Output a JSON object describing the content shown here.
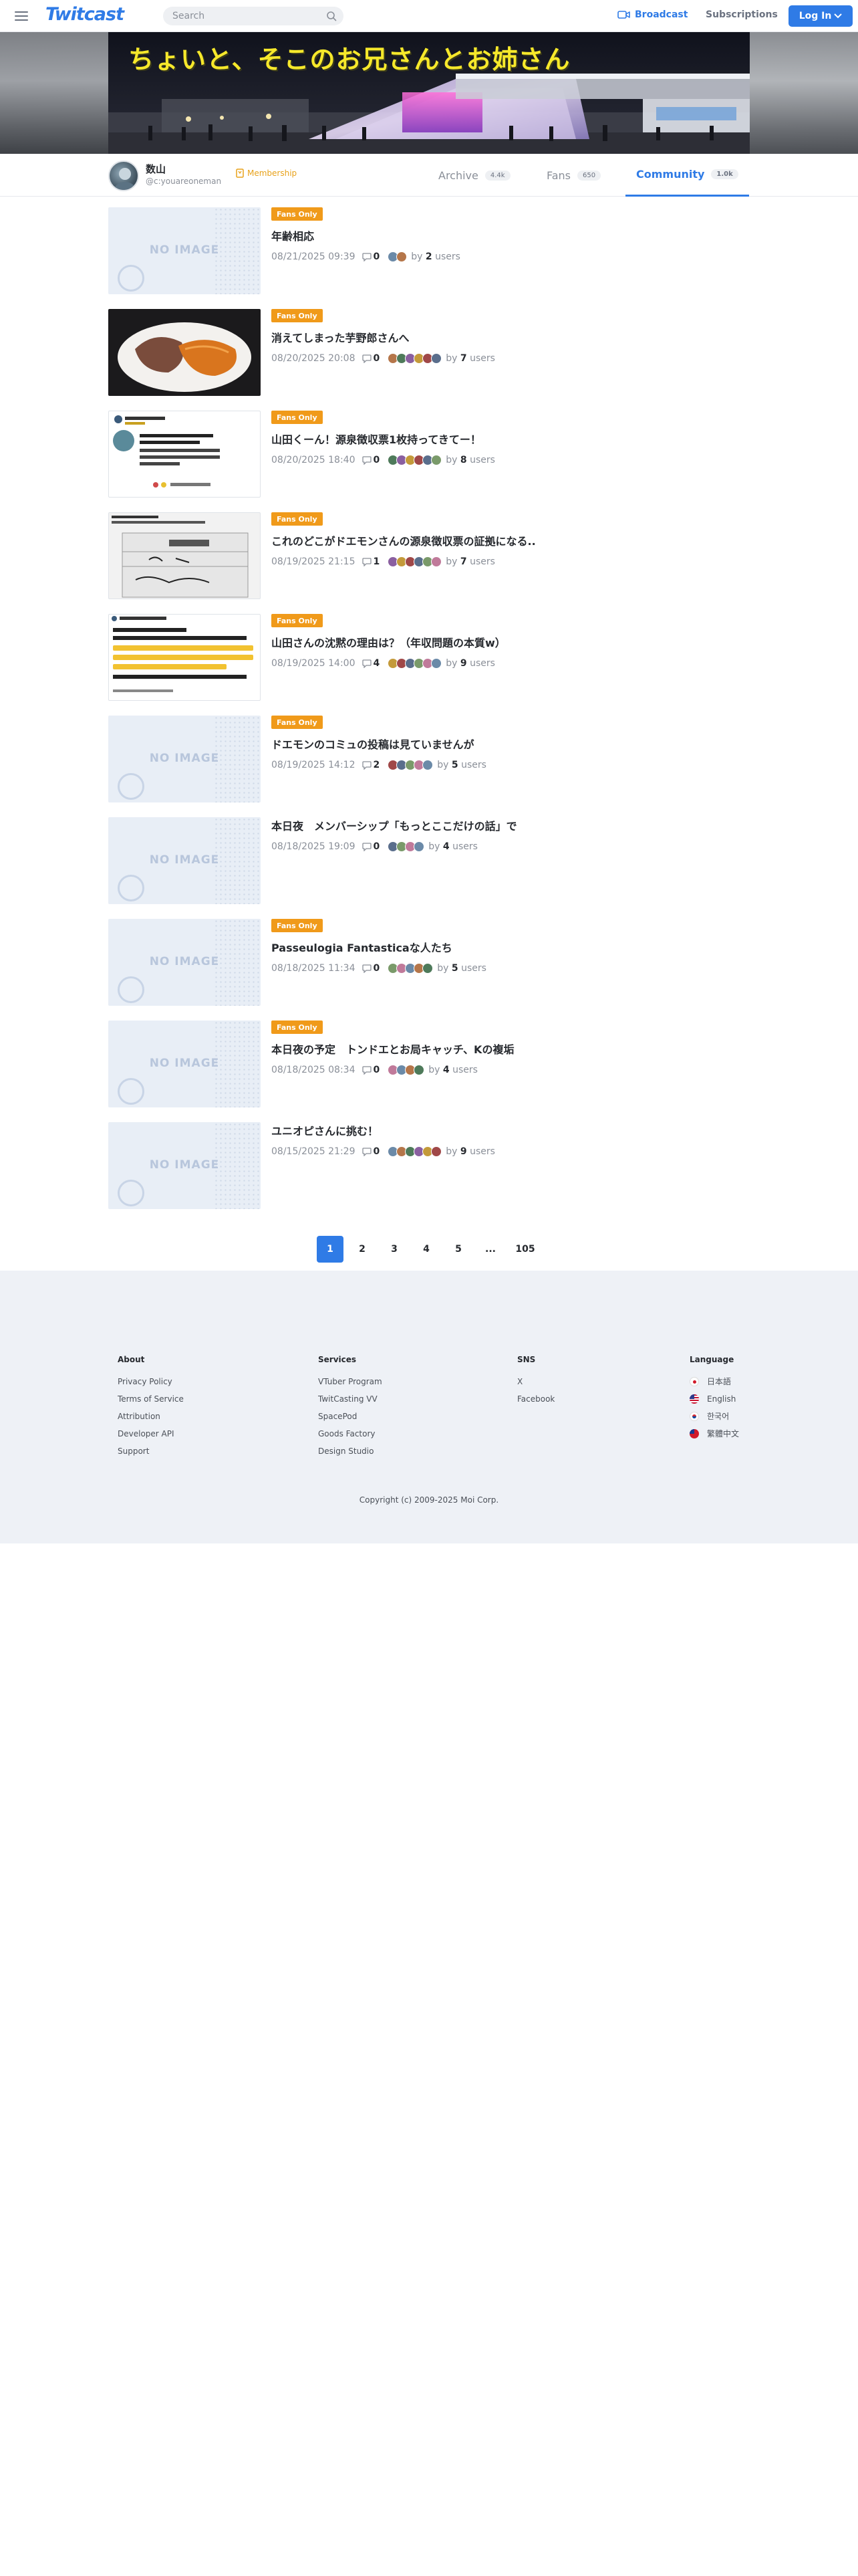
{
  "header": {
    "logo": "Twitcast",
    "search_placeholder": "Search",
    "broadcast_label": "Broadcast",
    "subscriptions_label": "Subscriptions",
    "login_label": "Log In"
  },
  "banner": {
    "title": "ちょいと、そこのお兄さんとお姉さん"
  },
  "profile": {
    "name": "数山",
    "handle": "@c:youareoneman",
    "membership_label": "Membership"
  },
  "tabs": [
    {
      "label": "Archive",
      "count": "4.4k"
    },
    {
      "label": "Fans",
      "count": "650"
    },
    {
      "label": "Community",
      "count": "1.0k"
    }
  ],
  "posts": [
    {
      "badge": "Fans Only",
      "title": "年齢相応",
      "date": "08/21/2025 09:39",
      "comments": "0",
      "users": "2",
      "thumb": "noimage"
    },
    {
      "badge": "Fans Only",
      "title": "消えてしまった芋野郎さんへ",
      "date": "08/20/2025 20:08",
      "comments": "0",
      "users": "7",
      "thumb": "food"
    },
    {
      "badge": "Fans Only",
      "title": "山田くーん！源泉徴収票1枚持ってきてー！",
      "date": "08/20/2025 18:40",
      "comments": "0",
      "users": "8",
      "thumb": "tweet"
    },
    {
      "badge": "Fans Only",
      "title": "これのどこがドエモンさんの源泉徴収票の証拠になる..",
      "date": "08/19/2025 21:15",
      "comments": "1",
      "users": "7",
      "thumb": "note"
    },
    {
      "badge": "Fans Only",
      "title": "山田さんの沈黙の理由は？（年収問題の本質w）",
      "date": "08/19/2025 14:00",
      "comments": "4",
      "users": "9",
      "thumb": "tweet2"
    },
    {
      "badge": "Fans Only",
      "title": "ドエモンのコミュの投稿は見ていませんが",
      "date": "08/19/2025 14:12",
      "comments": "2",
      "users": "5",
      "thumb": "noimage"
    },
    {
      "badge": "",
      "title": "本日夜　メンバーシップ「もっとここだけの話」で",
      "date": "08/18/2025 19:09",
      "comments": "0",
      "users": "4",
      "thumb": "noimage"
    },
    {
      "badge": "Fans Only",
      "title": "Passeulogia Fantasticaな人たち",
      "date": "08/18/2025 11:34",
      "comments": "0",
      "users": "5",
      "thumb": "noimage"
    },
    {
      "badge": "Fans Only",
      "title": "本日夜の予定　トンドエとお局キャッチ、Kの複垢",
      "date": "08/18/2025 08:34",
      "comments": "0",
      "users": "4",
      "thumb": "noimage"
    },
    {
      "badge": "",
      "title": "ユニオピさんに挑む！",
      "date": "08/15/2025 21:29",
      "comments": "0",
      "users": "9",
      "thumb": "noimage"
    }
  ],
  "meta_by": "by",
  "meta_users": "users",
  "noimage_text": "NO IMAGE",
  "pagination": [
    "1",
    "2",
    "3",
    "4",
    "5",
    "...",
    "105"
  ],
  "footer": {
    "about": {
      "heading": "About",
      "links": [
        "Privacy Policy",
        "Terms of Service",
        "Attribution",
        "Developer API",
        "Support"
      ]
    },
    "services": {
      "heading": "Services",
      "links": [
        "VTuber Program",
        "TwitCasting VV",
        "SpacePod",
        "Goods Factory",
        "Design Studio"
      ]
    },
    "sns": {
      "heading": "SNS",
      "links": [
        "X",
        "Facebook"
      ]
    },
    "language": {
      "heading": "Language",
      "links": [
        "日本語",
        "English",
        "한국어",
        "繁體中文"
      ]
    },
    "copyright": "Copyright (c) 2009-2025 Moi Corp."
  },
  "colors": {
    "accent": "#2f7be6",
    "badge": "#f09a1a",
    "footer_bg": "#eef1f6"
  }
}
